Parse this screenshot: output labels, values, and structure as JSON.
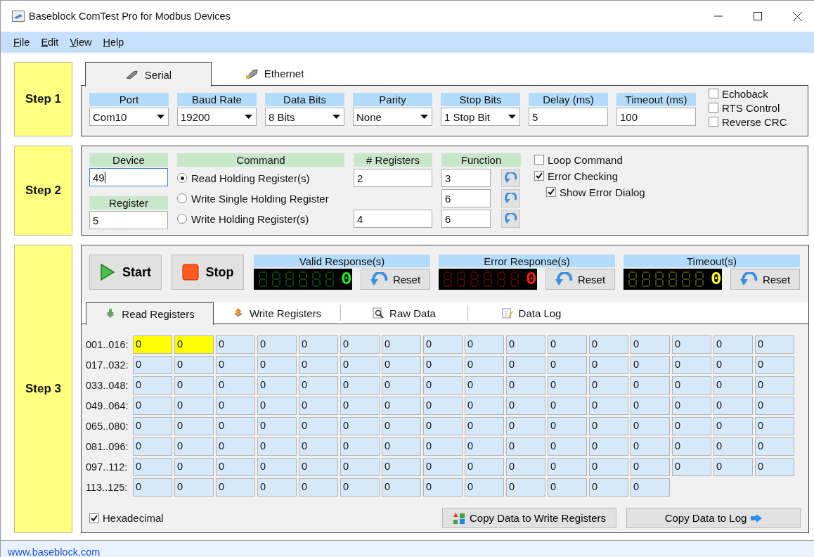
{
  "window": {
    "title": "Baseblock ComTest Pro for Modbus Devices"
  },
  "menu": [
    {
      "label": "File"
    },
    {
      "label": "Edit"
    },
    {
      "label": "View"
    },
    {
      "label": "Help"
    }
  ],
  "step1": {
    "label": "Step 1",
    "tabs": [
      {
        "label": "Serial",
        "selected": true
      },
      {
        "label": "Ethernet",
        "selected": false
      }
    ],
    "fields": [
      {
        "label": "Port",
        "kind": "dropdown",
        "value": "Com10"
      },
      {
        "label": "Baud Rate",
        "kind": "dropdown",
        "value": "19200"
      },
      {
        "label": "Data Bits",
        "kind": "dropdown",
        "value": "8 Bits"
      },
      {
        "label": "Parity",
        "kind": "dropdown",
        "value": "None"
      },
      {
        "label": "Stop Bits",
        "kind": "dropdown",
        "value": "1 Stop Bit"
      },
      {
        "label": "Delay (ms)",
        "kind": "text",
        "value": "5"
      },
      {
        "label": "Timeout (ms)",
        "kind": "text",
        "value": "100"
      }
    ],
    "options": [
      {
        "label": "Echoback",
        "checked": false
      },
      {
        "label": "RTS Control",
        "checked": false
      },
      {
        "label": "Reverse CRC",
        "checked": false
      }
    ]
  },
  "step2": {
    "label": "Step 2",
    "device": {
      "label": "Device",
      "value": "49",
      "focused": true
    },
    "register": {
      "label": "Register",
      "value": "5"
    },
    "command_header": "Command",
    "registers_header": "# Registers",
    "function_header": "Function",
    "commands": [
      {
        "label": "Read Holding Register(s)",
        "selected": true,
        "registers": "2",
        "function": "3"
      },
      {
        "label": "Write Single Holding Register",
        "selected": false,
        "function": "6"
      },
      {
        "label": "Write Holding Register(s)",
        "selected": false,
        "registers": "4",
        "function": "6"
      }
    ],
    "options": [
      {
        "label": "Loop Command",
        "checked": false
      },
      {
        "label": "Error Checking",
        "checked": true,
        "children": [
          {
            "label": "Show Error Dialog",
            "checked": true
          }
        ]
      }
    ]
  },
  "step3": {
    "label": "Step 3",
    "start": "Start",
    "stop": "Stop",
    "counters": [
      {
        "label": "Valid Response(s)",
        "value": "0",
        "color": "#22ee22",
        "reset": "Reset"
      },
      {
        "label": "Error Response(s)",
        "value": "0",
        "color": "#ff1a1a",
        "reset": "Reset"
      },
      {
        "label": "Timeout(s)",
        "value": "0",
        "color": "#ffff22",
        "reset": "Reset"
      }
    ],
    "tabs": [
      {
        "label": "Read Registers",
        "selected": true
      },
      {
        "label": "Write Registers",
        "selected": false
      },
      {
        "label": "Raw Data",
        "selected": false
      },
      {
        "label": "Data Log",
        "selected": false
      }
    ],
    "rows": [
      {
        "label": "001..016:",
        "cells": [
          {
            "value": "0",
            "highlighted": true
          },
          {
            "value": "0",
            "highlighted": true
          },
          {
            "value": "0",
            "highlighted": false
          },
          {
            "value": "0",
            "highlighted": false
          },
          {
            "value": "0",
            "highlighted": false
          },
          {
            "value": "0",
            "highlighted": false
          },
          {
            "value": "0",
            "highlighted": false
          },
          {
            "value": "0",
            "highlighted": false
          },
          {
            "value": "0",
            "highlighted": false
          },
          {
            "value": "0",
            "highlighted": false
          },
          {
            "value": "0",
            "highlighted": false
          },
          {
            "value": "0",
            "highlighted": false
          },
          {
            "value": "0",
            "highlighted": false
          },
          {
            "value": "0",
            "highlighted": false
          },
          {
            "value": "0",
            "highlighted": false
          },
          {
            "value": "0",
            "highlighted": false
          }
        ]
      },
      {
        "label": "017..032:",
        "cells": [
          {
            "value": "0",
            "highlighted": false
          },
          {
            "value": "0",
            "highlighted": false
          },
          {
            "value": "0",
            "highlighted": false
          },
          {
            "value": "0",
            "highlighted": false
          },
          {
            "value": "0",
            "highlighted": false
          },
          {
            "value": "0",
            "highlighted": false
          },
          {
            "value": "0",
            "highlighted": false
          },
          {
            "value": "0",
            "highlighted": false
          },
          {
            "value": "0",
            "highlighted": false
          },
          {
            "value": "0",
            "highlighted": false
          },
          {
            "value": "0",
            "highlighted": false
          },
          {
            "value": "0",
            "highlighted": false
          },
          {
            "value": "0",
            "highlighted": false
          },
          {
            "value": "0",
            "highlighted": false
          },
          {
            "value": "0",
            "highlighted": false
          },
          {
            "value": "0",
            "highlighted": false
          }
        ]
      },
      {
        "label": "033..048:",
        "cells": [
          {
            "value": "0",
            "highlighted": false
          },
          {
            "value": "0",
            "highlighted": false
          },
          {
            "value": "0",
            "highlighted": false
          },
          {
            "value": "0",
            "highlighted": false
          },
          {
            "value": "0",
            "highlighted": false
          },
          {
            "value": "0",
            "highlighted": false
          },
          {
            "value": "0",
            "highlighted": false
          },
          {
            "value": "0",
            "highlighted": false
          },
          {
            "value": "0",
            "highlighted": false
          },
          {
            "value": "0",
            "highlighted": false
          },
          {
            "value": "0",
            "highlighted": false
          },
          {
            "value": "0",
            "highlighted": false
          },
          {
            "value": "0",
            "highlighted": false
          },
          {
            "value": "0",
            "highlighted": false
          },
          {
            "value": "0",
            "highlighted": false
          },
          {
            "value": "0",
            "highlighted": false
          }
        ]
      },
      {
        "label": "049..064:",
        "cells": [
          {
            "value": "0",
            "highlighted": false
          },
          {
            "value": "0",
            "highlighted": false
          },
          {
            "value": "0",
            "highlighted": false
          },
          {
            "value": "0",
            "highlighted": false
          },
          {
            "value": "0",
            "highlighted": false
          },
          {
            "value": "0",
            "highlighted": false
          },
          {
            "value": "0",
            "highlighted": false
          },
          {
            "value": "0",
            "highlighted": false
          },
          {
            "value": "0",
            "highlighted": false
          },
          {
            "value": "0",
            "highlighted": false
          },
          {
            "value": "0",
            "highlighted": false
          },
          {
            "value": "0",
            "highlighted": false
          },
          {
            "value": "0",
            "highlighted": false
          },
          {
            "value": "0",
            "highlighted": false
          },
          {
            "value": "0",
            "highlighted": false
          },
          {
            "value": "0",
            "highlighted": false
          }
        ]
      },
      {
        "label": "065..080:",
        "cells": [
          {
            "value": "0",
            "highlighted": false
          },
          {
            "value": "0",
            "highlighted": false
          },
          {
            "value": "0",
            "highlighted": false
          },
          {
            "value": "0",
            "highlighted": false
          },
          {
            "value": "0",
            "highlighted": false
          },
          {
            "value": "0",
            "highlighted": false
          },
          {
            "value": "0",
            "highlighted": false
          },
          {
            "value": "0",
            "highlighted": false
          },
          {
            "value": "0",
            "highlighted": false
          },
          {
            "value": "0",
            "highlighted": false
          },
          {
            "value": "0",
            "highlighted": false
          },
          {
            "value": "0",
            "highlighted": false
          },
          {
            "value": "0",
            "highlighted": false
          },
          {
            "value": "0",
            "highlighted": false
          },
          {
            "value": "0",
            "highlighted": false
          },
          {
            "value": "0",
            "highlighted": false
          }
        ]
      },
      {
        "label": "081..096:",
        "cells": [
          {
            "value": "0",
            "highlighted": false
          },
          {
            "value": "0",
            "highlighted": false
          },
          {
            "value": "0",
            "highlighted": false
          },
          {
            "value": "0",
            "highlighted": false
          },
          {
            "value": "0",
            "highlighted": false
          },
          {
            "value": "0",
            "highlighted": false
          },
          {
            "value": "0",
            "highlighted": false
          },
          {
            "value": "0",
            "highlighted": false
          },
          {
            "value": "0",
            "highlighted": false
          },
          {
            "value": "0",
            "highlighted": false
          },
          {
            "value": "0",
            "highlighted": false
          },
          {
            "value": "0",
            "highlighted": false
          },
          {
            "value": "0",
            "highlighted": false
          },
          {
            "value": "0",
            "highlighted": false
          },
          {
            "value": "0",
            "highlighted": false
          },
          {
            "value": "0",
            "highlighted": false
          }
        ]
      },
      {
        "label": "097..112:",
        "cells": [
          {
            "value": "0",
            "highlighted": false
          },
          {
            "value": "0",
            "highlighted": false
          },
          {
            "value": "0",
            "highlighted": false
          },
          {
            "value": "0",
            "highlighted": false
          },
          {
            "value": "0",
            "highlighted": false
          },
          {
            "value": "0",
            "highlighted": false
          },
          {
            "value": "0",
            "highlighted": false
          },
          {
            "value": "0",
            "highlighted": false
          },
          {
            "value": "0",
            "highlighted": false
          },
          {
            "value": "0",
            "highlighted": false
          },
          {
            "value": "0",
            "highlighted": false
          },
          {
            "value": "0",
            "highlighted": false
          },
          {
            "value": "0",
            "highlighted": false
          },
          {
            "value": "0",
            "highlighted": false
          },
          {
            "value": "0",
            "highlighted": false
          },
          {
            "value": "0",
            "highlighted": false
          }
        ]
      },
      {
        "label": "113..125:",
        "cells": [
          {
            "value": "0",
            "highlighted": false
          },
          {
            "value": "0",
            "highlighted": false
          },
          {
            "value": "0",
            "highlighted": false
          },
          {
            "value": "0",
            "highlighted": false
          },
          {
            "value": "0",
            "highlighted": false
          },
          {
            "value": "0",
            "highlighted": false
          },
          {
            "value": "0",
            "highlighted": false
          },
          {
            "value": "0",
            "highlighted": false
          },
          {
            "value": "0",
            "highlighted": false
          },
          {
            "value": "0",
            "highlighted": false
          },
          {
            "value": "0",
            "highlighted": false
          },
          {
            "value": "0",
            "highlighted": false
          },
          {
            "value": "0",
            "highlighted": false
          }
        ]
      }
    ],
    "hexadecimal": {
      "label": "Hexadecimal",
      "checked": true
    },
    "copy_to_write": "Copy Data to Write Registers",
    "copy_to_log": "Copy Data to Log"
  },
  "status_bar": {
    "link": "www.baseblock.com"
  }
}
